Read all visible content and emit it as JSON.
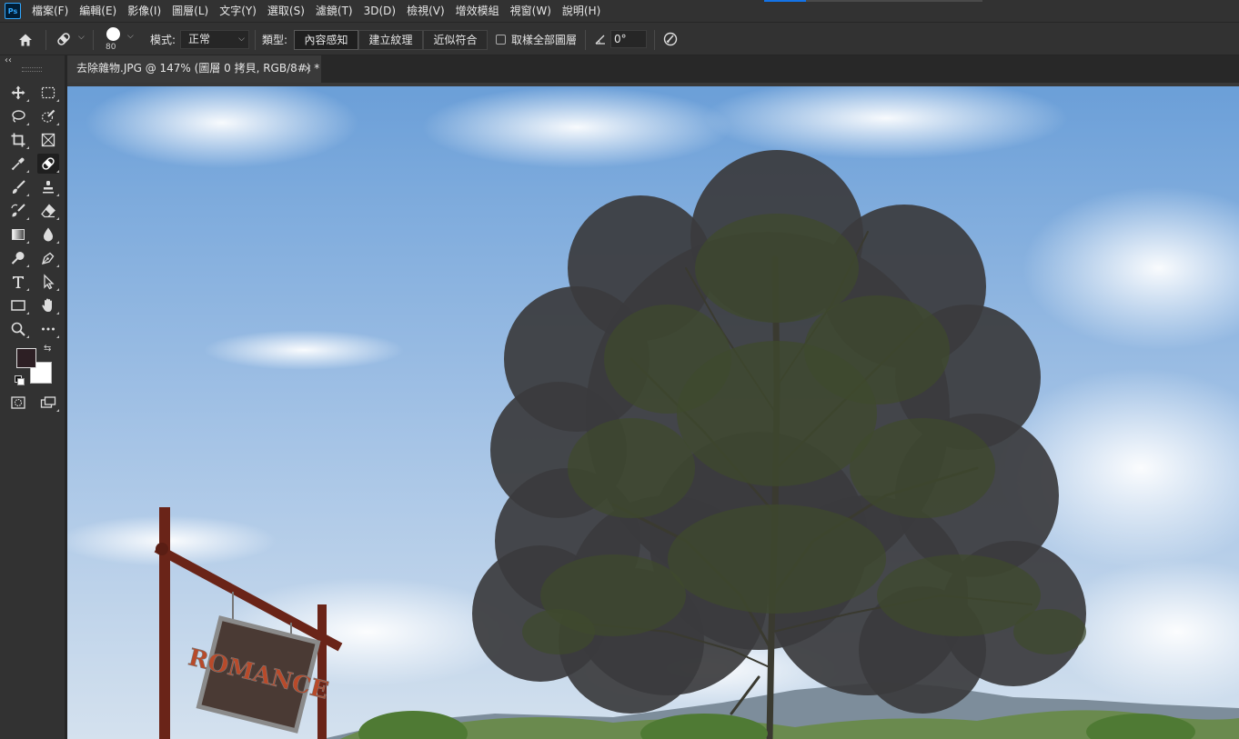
{
  "app": {
    "logo": "Ps"
  },
  "menu": [
    "檔案(F)",
    "編輯(E)",
    "影像(I)",
    "圖層(L)",
    "文字(Y)",
    "選取(S)",
    "濾鏡(T)",
    "3D(D)",
    "檢視(V)",
    "增效模組",
    "視窗(W)",
    "說明(H)"
  ],
  "options": {
    "brush_size": "80",
    "mode_label": "模式:",
    "mode_value": "正常",
    "type_label": "類型:",
    "type_options": [
      "內容感知",
      "建立紋理",
      "近似符合"
    ],
    "type_selected": "內容感知",
    "sample_all_layers": "取樣全部圖層",
    "angle_value": "0°"
  },
  "document": {
    "tab_title": "去除雜物.JPG @ 147% (圖層 0 拷貝, RGB/8#) *",
    "close": "×",
    "sign_text": "ROMANCE"
  },
  "colors": {
    "foreground": "#2d1f24",
    "background": "#ffffff",
    "accent": "#1473e6"
  },
  "tools": [
    "move-icon",
    "marquee-icon",
    "lasso-icon",
    "quick-select-icon",
    "crop-icon",
    "frame-icon",
    "eyedropper-icon",
    "healing-brush-icon",
    "brush-icon",
    "clone-stamp-icon",
    "history-brush-icon",
    "eraser-icon",
    "gradient-icon",
    "blur-icon",
    "dodge-icon",
    "pen-icon",
    "type-icon",
    "path-select-icon",
    "rectangle-icon",
    "hand-icon",
    "zoom-icon",
    "more-tools-icon",
    "quick-mask-icon",
    "screen-mode-icon"
  ]
}
